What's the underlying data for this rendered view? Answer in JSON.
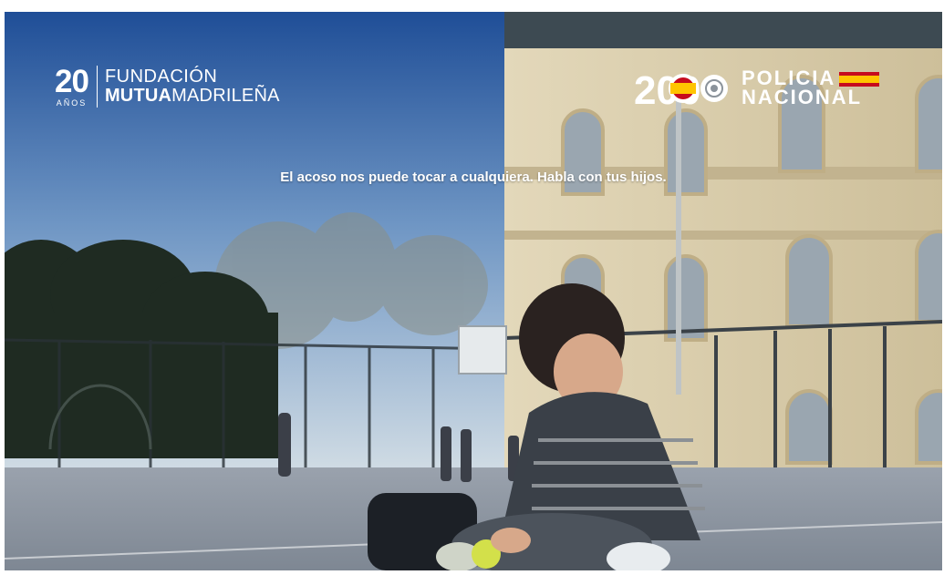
{
  "logo_fundacion": {
    "years_number": "20",
    "years_word": "AÑOS",
    "line1": "FUNDACIÓN",
    "line2_bold": "MUTUA",
    "line2_rest": "MADRILEÑA"
  },
  "logo_policia": {
    "number": "200",
    "line1": "POLICIA",
    "line2": "NACIONAL"
  },
  "tagline": "El acoso nos puede tocar a cualquiera. Habla con tus hijos.",
  "colors": {
    "sky_top": "#1f5aa8",
    "sky_bottom": "#c9d8e6",
    "building": "#d8c9a4",
    "court": "#8a93a0",
    "text": "#ffffff",
    "flag_red": "#c60b1e",
    "flag_yellow": "#ffc400"
  }
}
